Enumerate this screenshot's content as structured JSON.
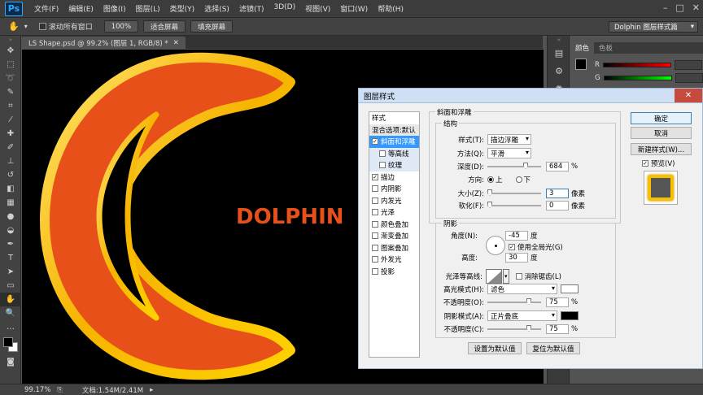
{
  "app": {
    "logo": "Ps"
  },
  "menubar": [
    "文件(F)",
    "编辑(E)",
    "图像(I)",
    "图层(L)",
    "类型(Y)",
    "选择(S)",
    "滤镜(T)",
    "3D(D)",
    "视图(V)",
    "窗口(W)",
    "帮助(H)"
  ],
  "window_controls": [
    "–",
    "□",
    "✕"
  ],
  "options_bar": {
    "scroll_all_label": "滚动所有窗口",
    "zoom_100": "100%",
    "fit_screen": "适合屏幕",
    "fill_screen": "填充屏幕",
    "workspace": "Dolphin 图层样式篇"
  },
  "document": {
    "tab_title": "LS Shape.psd @ 99.2% (图层 1, RGB/8) *",
    "canvas_text": "DOLPHIN",
    "colors": {
      "fill": "#e8501a",
      "stroke": "#f6c000",
      "text": "#e8501a"
    }
  },
  "status": {
    "zoom": "99.17%",
    "doc_info": "文档:1.54M/2.41M"
  },
  "color_panel": {
    "tabs": [
      "颜色",
      "色板"
    ],
    "channels": [
      {
        "label": "R"
      },
      {
        "label": "G"
      },
      {
        "label": "B"
      }
    ]
  },
  "dialog": {
    "title": "图层样式",
    "styles_header": "样式",
    "blend_options": "混合选项:默认",
    "styles": [
      {
        "label": "斜面和浮雕",
        "checked": true,
        "selected": true,
        "sub": false
      },
      {
        "label": "等高线",
        "checked": false,
        "selected": false,
        "sub": true
      },
      {
        "label": "纹理",
        "checked": false,
        "selected": false,
        "sub": true
      },
      {
        "label": "描边",
        "checked": true,
        "selected": false,
        "sub": false
      },
      {
        "label": "内阴影",
        "checked": false,
        "selected": false,
        "sub": false
      },
      {
        "label": "内发光",
        "checked": false,
        "selected": false,
        "sub": false
      },
      {
        "label": "光泽",
        "checked": false,
        "selected": false,
        "sub": false
      },
      {
        "label": "颜色叠加",
        "checked": false,
        "selected": false,
        "sub": false
      },
      {
        "label": "渐变叠加",
        "checked": false,
        "selected": false,
        "sub": false
      },
      {
        "label": "图案叠加",
        "checked": false,
        "selected": false,
        "sub": false
      },
      {
        "label": "外发光",
        "checked": false,
        "selected": false,
        "sub": false
      },
      {
        "label": "投影",
        "checked": false,
        "selected": false,
        "sub": false
      }
    ],
    "bevel": {
      "section_title": "斜面和浮雕",
      "structure_title": "结构",
      "style_label": "样式(T):",
      "style_value": "描边浮雕",
      "technique_label": "方法(Q):",
      "technique_value": "平滑",
      "depth_label": "深度(D):",
      "depth_value": "684",
      "depth_unit": "%",
      "direction_label": "方向:",
      "direction_up": "上",
      "direction_down": "下",
      "size_label": "大小(Z):",
      "size_value": "3",
      "size_unit": "像素",
      "soften_label": "软化(F):",
      "soften_value": "0",
      "soften_unit": "像素"
    },
    "shading": {
      "title": "阴影",
      "angle_label": "角度(N):",
      "angle_value": "-45",
      "angle_unit": "度",
      "global_light_label": "使用全局光(G)",
      "altitude_label": "高度:",
      "altitude_value": "30",
      "altitude_unit": "度",
      "gloss_label": "光泽等高线:",
      "antialias_label": "消除锯齿(L)",
      "highlight_mode_label": "高光模式(H):",
      "highlight_mode_value": "滤色",
      "highlight_opacity_label": "不透明度(O):",
      "highlight_opacity_value": "75",
      "shadow_mode_label": "阴影模式(A):",
      "shadow_mode_value": "正片叠底",
      "shadow_opacity_label": "不透明度(C):",
      "shadow_opacity_value": "75",
      "percent": "%",
      "highlight_color": "#ffffff",
      "shadow_color": "#000000"
    },
    "buttons": {
      "set_default": "设置为默认值",
      "reset_default": "复位为默认值",
      "ok": "确定",
      "cancel": "取消",
      "new_style": "新建样式(W)...",
      "preview": "预览(V)"
    }
  }
}
